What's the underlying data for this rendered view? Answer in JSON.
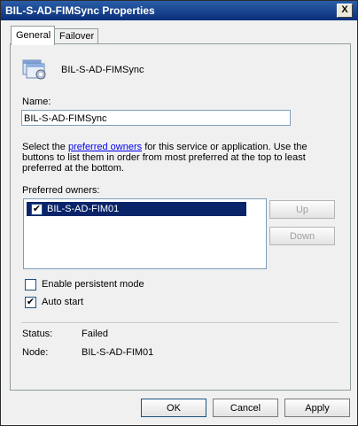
{
  "window": {
    "title": "BIL-S-AD-FIMSync Properties",
    "close_label": "X"
  },
  "tabs": [
    {
      "label": "General",
      "active": true
    },
    {
      "label": "Failover",
      "active": false
    }
  ],
  "general": {
    "service_name": "BIL-S-AD-FIMSync",
    "name_label": "Name:",
    "name_value": "BIL-S-AD-FIMSync",
    "desc_before": "Select the ",
    "desc_link": "preferred owners",
    "desc_after": " for this service or application. Use the buttons to list them in order from most preferred at the top to least preferred at the bottom.",
    "owners_label": "Preferred owners:",
    "owners": [
      {
        "name": "BIL-S-AD-FIM01",
        "checked": true
      }
    ],
    "up_label": "Up",
    "down_label": "Down",
    "persistent_label": "Enable persistent mode",
    "persistent_checked": false,
    "autostart_label": "Auto start",
    "autostart_checked": true,
    "status_label": "Status:",
    "status_value": "Failed",
    "node_label": "Node:",
    "node_value": "BIL-S-AD-FIM01"
  },
  "footer": {
    "ok_label": "OK",
    "cancel_label": "Cancel",
    "apply_label": "Apply"
  },
  "colors": {
    "title_bar": "#0b2f7a",
    "selection": "#0a246a",
    "link": "#0000ee"
  }
}
